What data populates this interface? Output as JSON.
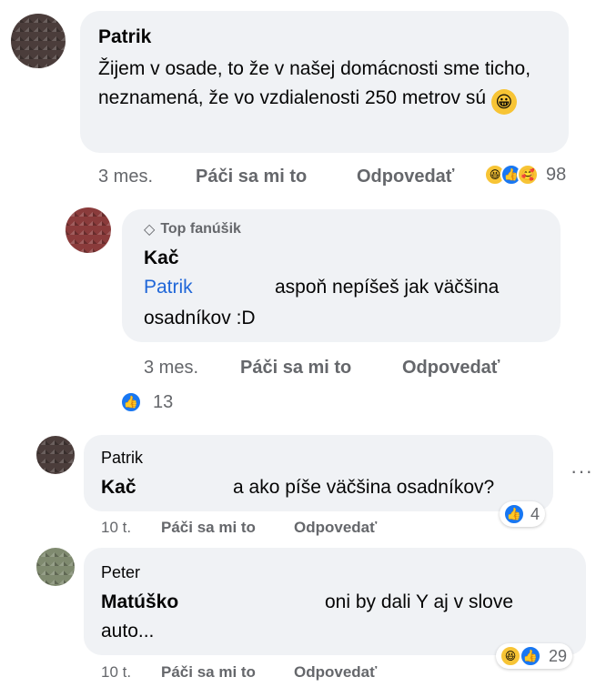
{
  "comments": [
    {
      "author": "Patrik",
      "text": "Žijem v osade, to že v našej domácnosti sme ticho, neznamená, že vo vzdialenosti 250 metrov sú",
      "emoji": "😀",
      "time": "3 mes.",
      "like_label": "Páči sa mi to",
      "reply_label": "Odpovedať",
      "reaction_count": "98",
      "reaction_icons": [
        "haha-icon",
        "like-icon",
        "care-icon"
      ]
    },
    {
      "badge": "Top fanúšik",
      "author": "Kač",
      "mention": "Patrik",
      "text_line1": "aspoň nepíšeš jak väčšina",
      "text_line2": "osadníkov :D",
      "time": "3 mes.",
      "like_label": "Páči sa mi to",
      "reply_label": "Odpovedať",
      "reaction_count": "13",
      "reaction_icons": [
        "like-icon"
      ]
    },
    {
      "author": "Patrik",
      "mention": "Kač",
      "text": "a ako píše väčšina osadníkov?",
      "time": "10 t.",
      "like_label": "Páči sa mi to",
      "reply_label": "Odpovedať",
      "reaction_count": "4",
      "reaction_icons": [
        "like-icon"
      ]
    },
    {
      "author": "Peter",
      "mention": "Matúško",
      "text_line1": "oni by dali Y aj v slove",
      "text_line2": "auto...",
      "time": "10 t.",
      "like_label": "Páči sa mi to",
      "reply_label": "Odpovedať",
      "reaction_count": "29",
      "reaction_icons": [
        "haha-icon",
        "like-icon"
      ]
    }
  ],
  "more_options": "···",
  "colors": {
    "bubble": "#f0f2f5",
    "mention": "#1f66d8",
    "meta": "#65676b",
    "like": "#1877f2"
  }
}
